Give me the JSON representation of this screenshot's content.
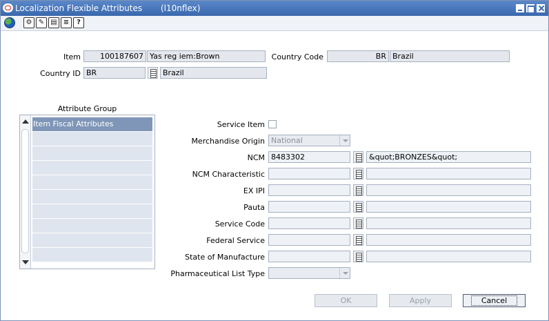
{
  "window": {
    "title": "Localization Flexible Attributes",
    "form_code": "(l10nflex)"
  },
  "toolbar": {
    "icons": [
      "globe-icon",
      "settings-icon",
      "edit-icon",
      "calendar-icon",
      "list-icon",
      "help-icon"
    ]
  },
  "header": {
    "item_label": "Item",
    "item_id": "100187607",
    "item_desc": "Yas reg iem:Brown",
    "country_code_label": "Country Code",
    "country_code": "BR",
    "country_code_desc": "Brazil",
    "country_id_label": "Country ID",
    "country_id": "BR",
    "country_id_desc": "Brazil"
  },
  "attribute_group": {
    "title": "Attribute Group",
    "rows": [
      "Item Fiscal Attributes",
      "",
      "",
      "",
      "",
      "",
      "",
      "",
      "",
      ""
    ]
  },
  "fields": {
    "service_item_label": "Service Item",
    "merch_origin_label": "Merchandise Origin",
    "merch_origin_value": "National",
    "ncm_label": "NCM",
    "ncm_value": "8483302",
    "ncm_desc": "&quot;BRONZES&quot;",
    "ncm_char_label": "NCM Characteristic",
    "ex_ipi_label": "EX IPI",
    "pauta_label": "Pauta",
    "service_code_label": "Service Code",
    "federal_service_label": "Federal Service",
    "state_manuf_label": "State of Manufacture",
    "pharma_label": "Pharmaceutical List Type"
  },
  "buttons": {
    "ok": "OK",
    "apply": "Apply",
    "cancel": "Cancel"
  },
  "colors": {
    "title_bar": "#3a68ad",
    "selected_row": "#7f96b8",
    "field_bg": "#e4e8ee"
  }
}
